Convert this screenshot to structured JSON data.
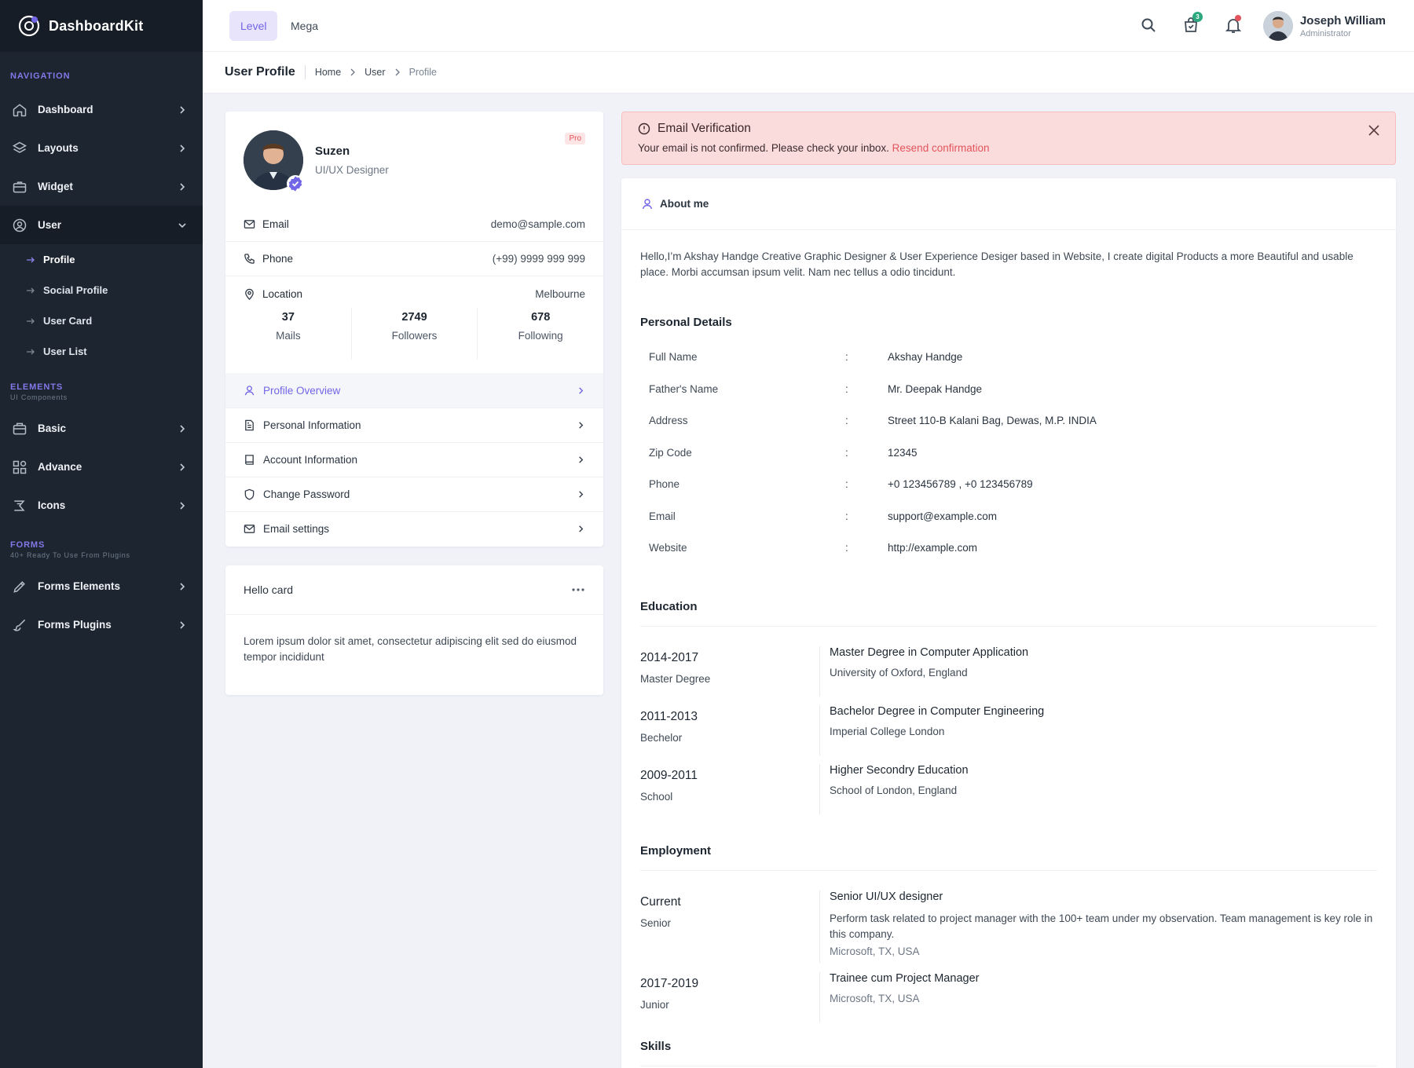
{
  "app": {
    "brand": "DashboardKit"
  },
  "sidebar": {
    "navigation_caption": "NAVIGATION",
    "items": [
      {
        "label": "Dashboard"
      },
      {
        "label": "Layouts"
      },
      {
        "label": "Widget"
      },
      {
        "label": "User"
      }
    ],
    "user_sub": [
      {
        "label": "Profile"
      },
      {
        "label": "Social Profile"
      },
      {
        "label": "User Card"
      },
      {
        "label": "User List"
      }
    ],
    "elements_caption": "ELEMENTS",
    "elements_sub": "UI Components",
    "element_items": [
      {
        "label": "Basic"
      },
      {
        "label": "Advance"
      },
      {
        "label": "Icons"
      }
    ],
    "forms_caption": "FORMS",
    "forms_sub": "40+ Ready To Use From Plugins",
    "form_items": [
      {
        "label": "Forms Elements"
      },
      {
        "label": "Forms Plugins"
      }
    ]
  },
  "header": {
    "menu": [
      {
        "label": "Level"
      },
      {
        "label": "Mega"
      }
    ],
    "cart_count": "3",
    "user_name": "Joseph William",
    "user_role": "Administrator"
  },
  "page": {
    "title": "User Profile",
    "breadcrumb": [
      "Home",
      "User",
      "Profile"
    ]
  },
  "profile": {
    "name": "Suzen",
    "role": "UI/UX Designer",
    "tag": "Pro",
    "info": [
      {
        "key": "Email",
        "value": "demo@sample.com"
      },
      {
        "key": "Phone",
        "value": "(+99) 9999 999 999"
      },
      {
        "key": "Location",
        "value": "Melbourne"
      }
    ],
    "stats": [
      {
        "num": "37",
        "label": "Mails"
      },
      {
        "num": "2749",
        "label": "Followers"
      },
      {
        "num": "678",
        "label": "Following"
      }
    ],
    "menu": [
      {
        "label": "Profile Overview"
      },
      {
        "label": "Personal Information"
      },
      {
        "label": "Account Information"
      },
      {
        "label": "Change Password"
      },
      {
        "label": "Email settings"
      }
    ]
  },
  "hello_card": {
    "title": "Hello card",
    "body": "Lorem ipsum dolor sit amet, consectetur adipiscing elit sed do eiusmod tempor incididunt"
  },
  "alert": {
    "title": "Email Verification",
    "text": "Your email is not confirmed. Please check your inbox. ",
    "link": "Resend confirmation"
  },
  "about": {
    "title": "About me",
    "text": "Hello,I’m Akshay Handge Creative Graphic Designer & User Experience Desiger based in Website, I create digital Products a more Beautiful and usable place. Morbi accumsan ipsum velit. Nam nec tellus a odio tincidunt.",
    "personal_title": "Personal Details",
    "separator": ":",
    "personal": [
      {
        "key": "Full Name",
        "value": "Akshay Handge"
      },
      {
        "key": "Father's Name",
        "value": "Mr. Deepak Handge"
      },
      {
        "key": "Address",
        "value": "Street 110-B Kalani Bag, Dewas, M.P. INDIA"
      },
      {
        "key": "Zip Code",
        "value": "12345"
      },
      {
        "key": "Phone",
        "value": "+0 123456789 , +0 123456789"
      },
      {
        "key": "Email",
        "value": "support@example.com"
      },
      {
        "key": "Website",
        "value": "http://example.com"
      }
    ],
    "education_title": "Education",
    "education": [
      {
        "years": "2014-2017",
        "degree": "Master Degree",
        "title": "Master Degree in Computer Application",
        "school": "University of Oxford, England"
      },
      {
        "years": "2011-2013",
        "degree": "Bechelor",
        "title": "Bachelor Degree in Computer Engineering",
        "school": "Imperial College London"
      },
      {
        "years": "2009-2011",
        "degree": "School",
        "title": "Higher Secondry Education",
        "school": "School of London, England"
      }
    ],
    "employment_title": "Employment",
    "employment": [
      {
        "period": "Current",
        "level": "Senior",
        "title": "Senior UI/UX designer",
        "desc": "Perform task related to project manager with the 100+ team under my observation. Team management is key role in this company.",
        "company": "Microsoft, TX, USA"
      },
      {
        "period": "2017-2019",
        "level": "Junior",
        "title": "Trainee cum Project Manager",
        "company": "Microsoft, TX, USA"
      }
    ],
    "skills_title": "Skills"
  },
  "colors": {
    "accent": "#7265e6",
    "sidebar_bg": "#1d2630",
    "alert_bg": "#fbdcdd",
    "danger": "#e2545b",
    "success": "#2ca87f"
  }
}
